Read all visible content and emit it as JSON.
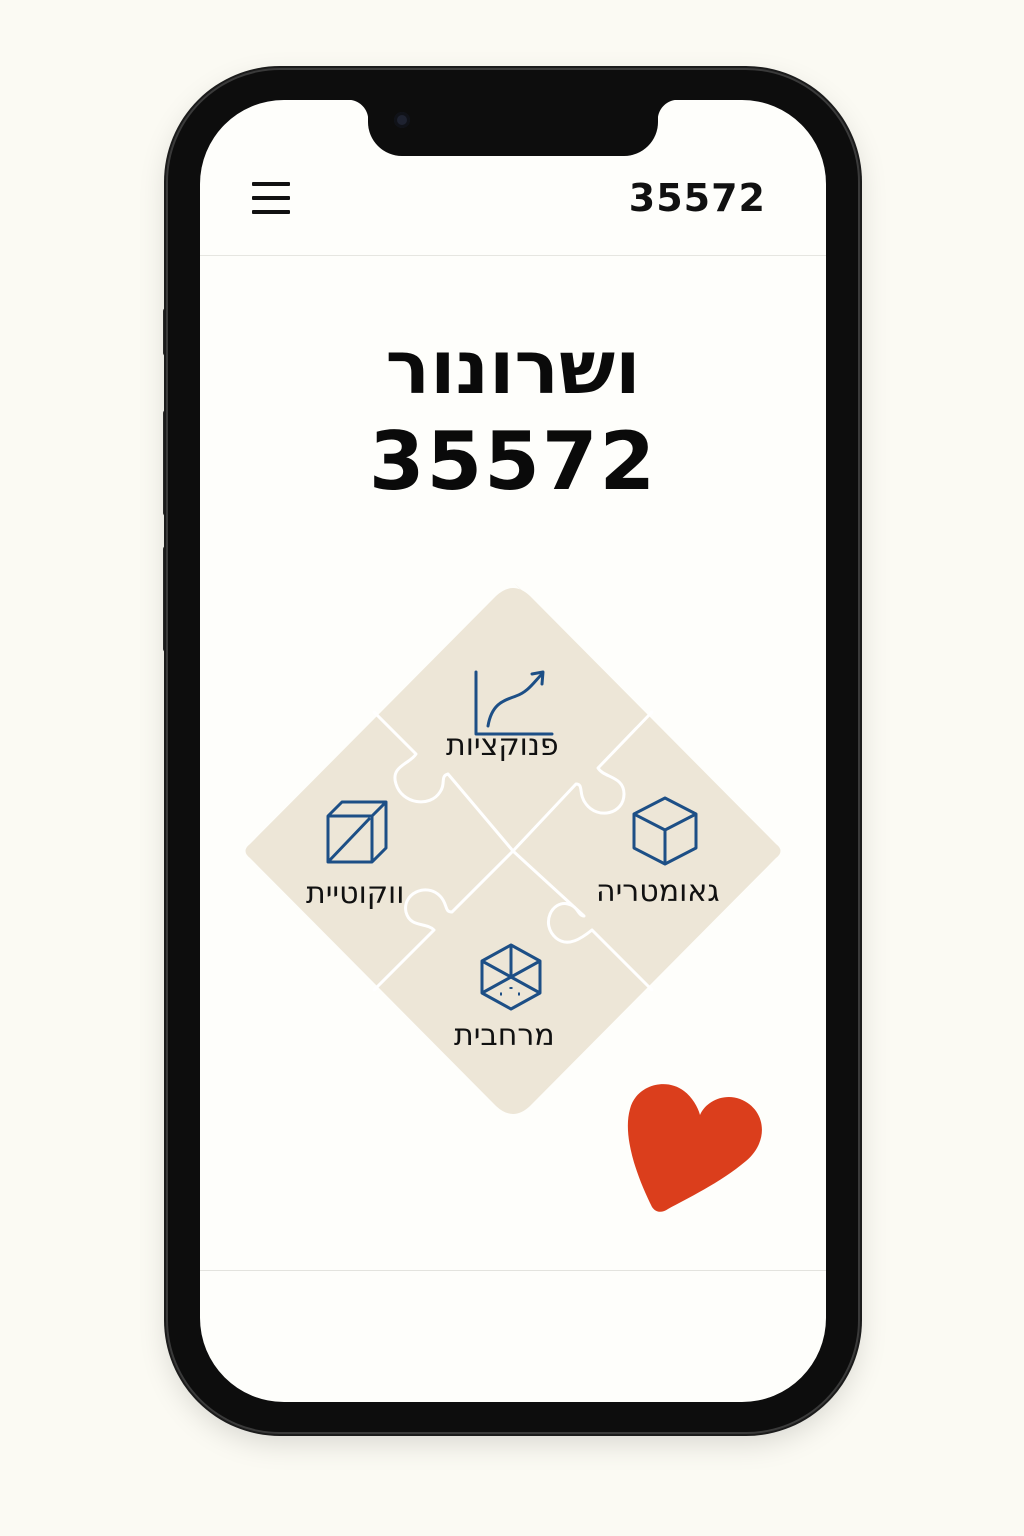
{
  "header": {
    "menu_icon": "hamburger-menu-icon",
    "number": "35572"
  },
  "main": {
    "title_word": "ושרונור",
    "title_number": "35572"
  },
  "puzzle": {
    "pieces": [
      {
        "label": "פנוקציות",
        "icon": "function-graph-icon"
      },
      {
        "label": "גאומטריה",
        "icon": "cube-icon"
      },
      {
        "label": "מרחבית",
        "icon": "hexagon-cube-icon"
      },
      {
        "label": "ווקוטיית",
        "icon": "cube-diagonal-icon"
      }
    ],
    "colors": {
      "piece_fill": "#ede6d7",
      "seam": "#ffffff",
      "icon_stroke": "#1d4f86"
    }
  },
  "favorite": {
    "icon": "heart-icon",
    "color": "#db3e1c"
  }
}
